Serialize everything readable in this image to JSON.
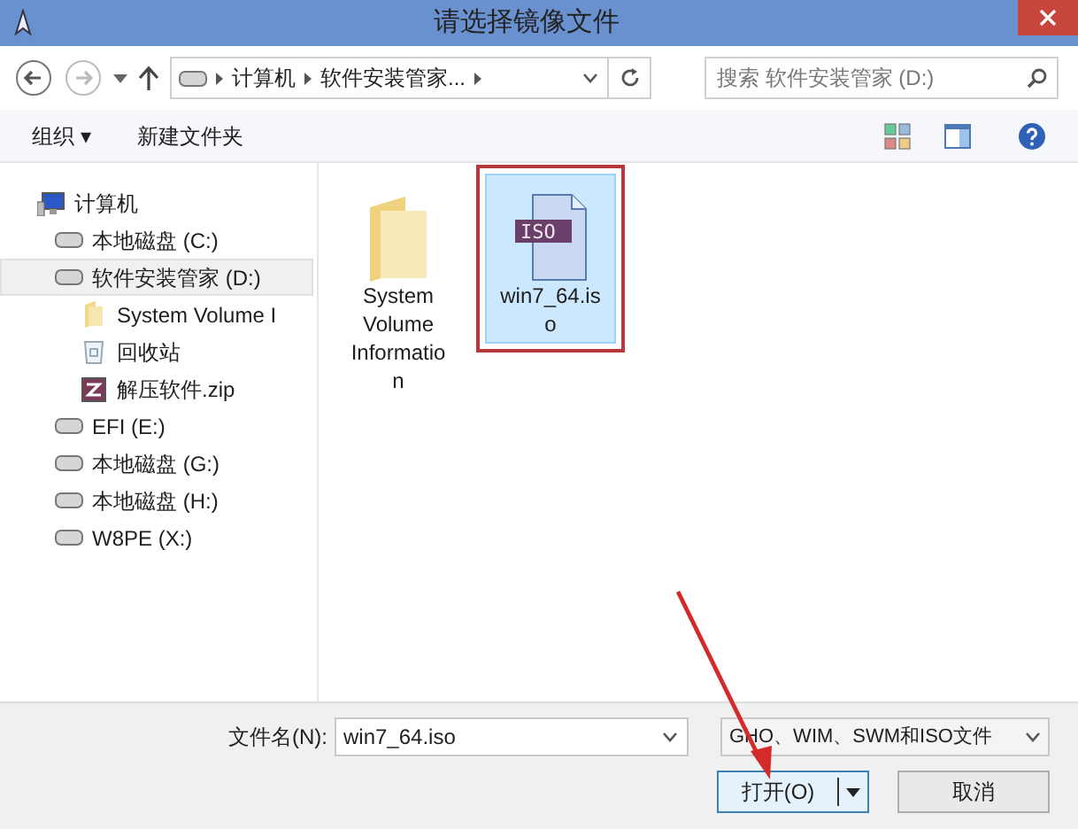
{
  "window": {
    "title": "请选择镜像文件"
  },
  "address_bar": {
    "crumbs": [
      "计算机",
      "软件安装管家..."
    ]
  },
  "search": {
    "placeholder": "搜索 软件安装管家 (D:)"
  },
  "toolbar": {
    "organize": "组织 ▾",
    "new_folder": "新建文件夹"
  },
  "sidebar": {
    "items": [
      {
        "label": "计算机",
        "kind": "computer",
        "selected": false,
        "children": [
          {
            "label": "本地磁盘 (C:)",
            "kind": "drive",
            "selected": false
          },
          {
            "label": "软件安装管家 (D:)",
            "kind": "drive",
            "selected": true,
            "children": [
              {
                "label": "System Volume I",
                "kind": "folder",
                "selected": false
              },
              {
                "label": "回收站",
                "kind": "recycle",
                "selected": false
              },
              {
                "label": "解压软件.zip",
                "kind": "zip",
                "selected": false
              }
            ]
          },
          {
            "label": "EFI (E:)",
            "kind": "drive",
            "selected": false
          },
          {
            "label": "本地磁盘 (G:)",
            "kind": "drive",
            "selected": false
          },
          {
            "label": "本地磁盘 (H:)",
            "kind": "drive",
            "selected": false
          },
          {
            "label": "W8PE (X:)",
            "kind": "drive",
            "selected": false
          }
        ]
      }
    ]
  },
  "files": [
    {
      "name": "System Volume Information",
      "kind": "folder",
      "selected": false,
      "annotated": false
    },
    {
      "name": "win7_64.iso",
      "kind": "iso",
      "icon_label": "ISO",
      "selected": true,
      "annotated": true
    }
  ],
  "footer": {
    "filename_label": "文件名(N):",
    "filename_value": "win7_64.iso",
    "filter": "GHO、WIM、SWM和ISO文件",
    "open": "打开(O)",
    "cancel": "取消"
  }
}
